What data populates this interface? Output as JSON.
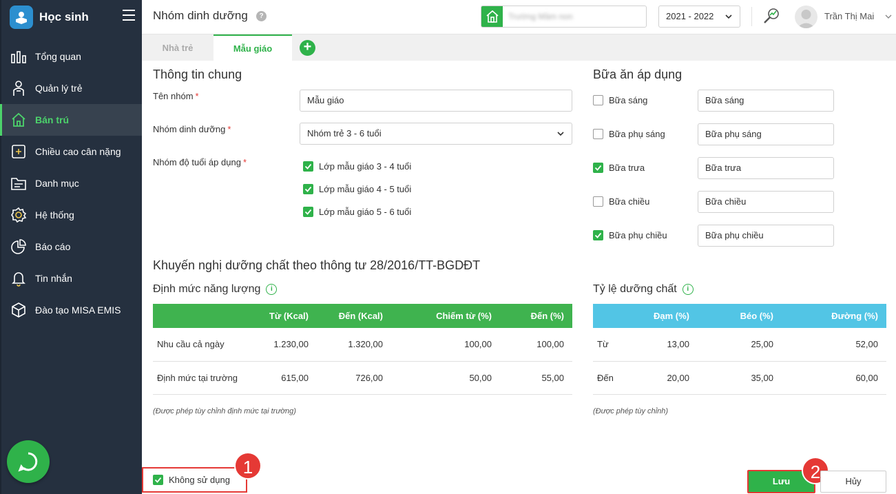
{
  "sidebar": {
    "title": "Học sinh",
    "items": [
      {
        "label": "Tổng quan",
        "icon": "bar-chart-icon"
      },
      {
        "label": "Quản lý trẻ",
        "icon": "child-icon"
      },
      {
        "label": "Bán trú",
        "icon": "house-icon",
        "active": true
      },
      {
        "label": "Chiều cao cân nặng",
        "icon": "plus-box-icon"
      },
      {
        "label": "Danh mục",
        "icon": "folder-icon"
      },
      {
        "label": "Hệ thống",
        "icon": "gear-icon"
      },
      {
        "label": "Báo cáo",
        "icon": "pie-chart-icon"
      },
      {
        "label": "Tin nhắn",
        "icon": "bell-icon"
      },
      {
        "label": "Đào tạo MISA EMIS",
        "icon": "box-icon"
      }
    ]
  },
  "header": {
    "page_title": "Nhóm dinh dưỡng",
    "help": "?",
    "school_name": "Trường Mầm non",
    "year": "2021 - 2022",
    "user_name": "Trần Thị Mai"
  },
  "tabs": {
    "items": [
      "Nhà trẻ",
      "Mẫu giáo"
    ],
    "add": "+"
  },
  "general": {
    "title": "Thông tin chung",
    "group_name_label": "Tên nhóm",
    "group_name_value": "Mẫu giáo",
    "nutrition_label": "Nhóm dinh dưỡng",
    "nutrition_value": "Nhóm trẻ 3 - 6 tuổi",
    "age_label": "Nhóm độ tuổi áp dụng",
    "required": "*",
    "ages": [
      {
        "label": "Lớp mẫu giáo 3 - 4 tuổi",
        "checked": true
      },
      {
        "label": "Lớp mẫu giáo 4 - 5 tuổi",
        "checked": true
      },
      {
        "label": "Lớp mẫu giáo 5 - 6 tuổi",
        "checked": true
      }
    ]
  },
  "meals": {
    "title": "Bữa ăn áp dụng",
    "items": [
      {
        "label": "Bữa sáng",
        "value": "Bữa sáng",
        "checked": false
      },
      {
        "label": "Bữa phụ sáng",
        "value": "Bữa phụ sáng",
        "checked": false
      },
      {
        "label": "Bữa trưa",
        "value": "Bữa trưa",
        "checked": true
      },
      {
        "label": "Bữa chiều",
        "value": "Bữa chiều",
        "checked": false
      },
      {
        "label": "Bữa phụ chiều",
        "value": "Bữa phụ chiều",
        "checked": true
      }
    ]
  },
  "recommend": {
    "title": "Khuyến nghị dưỡng chất theo thông tư 28/2016/TT-BGDĐT",
    "energy": {
      "title": "Định mức năng lượng",
      "headers": [
        "",
        "Từ (Kcal)",
        "Đến (Kcal)",
        "Chiếm từ (%)",
        "Đến (%)"
      ],
      "rows": [
        [
          "Nhu cầu cả ngày",
          "1.230,00",
          "1.320,00",
          "100,00",
          "100,00"
        ],
        [
          "Định mức tại trường",
          "615,00",
          "726,00",
          "50,00",
          "55,00"
        ]
      ],
      "note": "(Được phép tùy chỉnh định mức tại trường)"
    },
    "ratio": {
      "title": "Tỷ lệ dưỡng chất",
      "headers": [
        "",
        "Đạm (%)",
        "Béo (%)",
        "Đường (%)"
      ],
      "rows": [
        [
          "Từ",
          "13,00",
          "25,00",
          "52,00"
        ],
        [
          "Đến",
          "20,00",
          "35,00",
          "60,00"
        ]
      ],
      "note": "(Được phép tùy chỉnh)"
    }
  },
  "footer": {
    "not_use_label": "Không sử dụng",
    "not_use_checked": true,
    "save": "Lưu",
    "cancel": "Hủy",
    "badge1": "1",
    "badge2": "2"
  },
  "colors": {
    "accent": "#2fb24a",
    "sidebar_bg": "#25303f",
    "table_green": "#3fb34f",
    "table_blue": "#52c5e5",
    "annotation_red": "#e53935"
  }
}
